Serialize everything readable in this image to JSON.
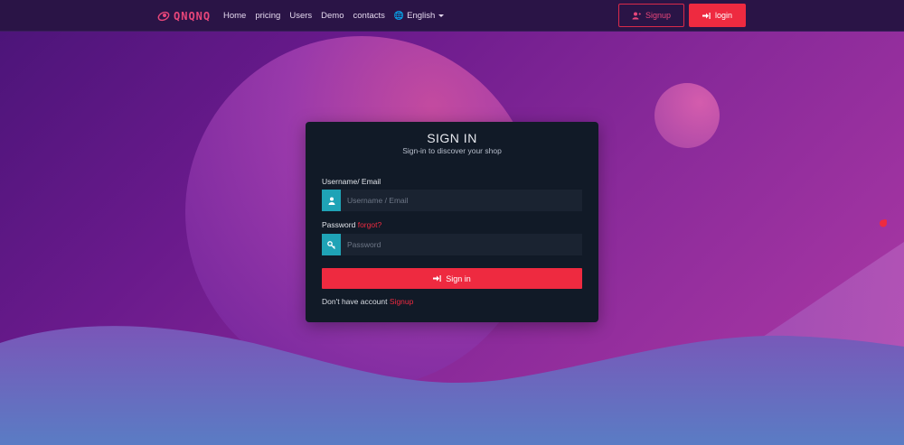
{
  "navbar": {
    "brand": "QNQNQ",
    "links": [
      "Home",
      "pricing",
      "Users",
      "Demo",
      "contacts"
    ],
    "language": "English",
    "signup_label": "Signup",
    "login_label": "login"
  },
  "signin_card": {
    "title": "SIGN IN",
    "subtitle": "Sign-in to discover your shop",
    "username_label": "Username/ Email",
    "username_placeholder": "Username / Email",
    "password_label": "Password",
    "forgot_label": "forgot?",
    "password_placeholder": "Password",
    "signin_button": "Sign in",
    "no_account_text": "Don't have account",
    "signup_link": "Signup"
  },
  "colors": {
    "accent": "#ee2a40",
    "input_icon_bg": "#1fa3b6",
    "card_bg": "#111a27",
    "navbar_bg": "#2a1446"
  },
  "icons": {
    "brand": "rocket-icon",
    "language": "globe-icon",
    "signup": "user-plus-icon",
    "login": "sign-in-icon",
    "username": "user-icon",
    "password": "key-icon"
  }
}
